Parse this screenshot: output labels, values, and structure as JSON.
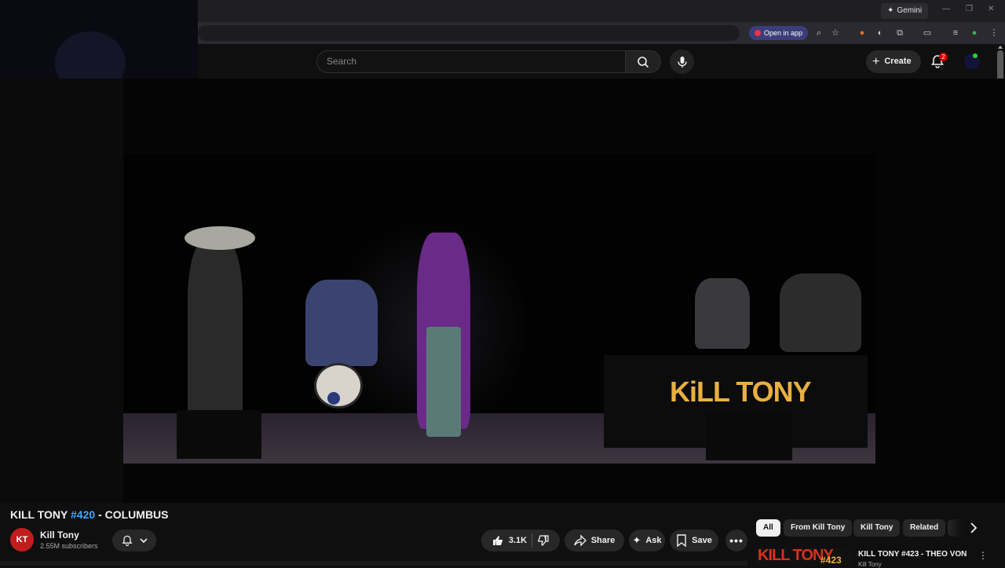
{
  "browser": {
    "gemini_label": "Gemini",
    "open_in_app_label": "Open in app"
  },
  "header": {
    "search_placeholder": "Search",
    "create_label": "Create",
    "notification_count": "2"
  },
  "video": {
    "title_prefix": "KILL TONY ",
    "title_tag": "#420",
    "title_suffix": " - COLUMBUS",
    "logo_text_main": "KiLL TONY"
  },
  "channel": {
    "avatar_text": "KT",
    "name": "Kill Tony",
    "subscribers": "2.55M subscribers"
  },
  "actions": {
    "like_count": "3.1K",
    "share_label": "Share",
    "ask_label": "Ask",
    "save_label": "Save"
  },
  "chips": [
    {
      "label": "All"
    },
    {
      "label": "From Kill Tony"
    },
    {
      "label": "Kill Tony"
    },
    {
      "label": "Related"
    }
  ],
  "recommendation": {
    "thumb_text": "KILL TONY",
    "thumb_num": "#423",
    "title": "KILL TONY #423 - THEO VON",
    "channel": "Kill Tony"
  },
  "colors": {
    "accent_link": "#3ea6ff",
    "brand_red": "#cc0000",
    "logo_gold": "#e8b040"
  }
}
